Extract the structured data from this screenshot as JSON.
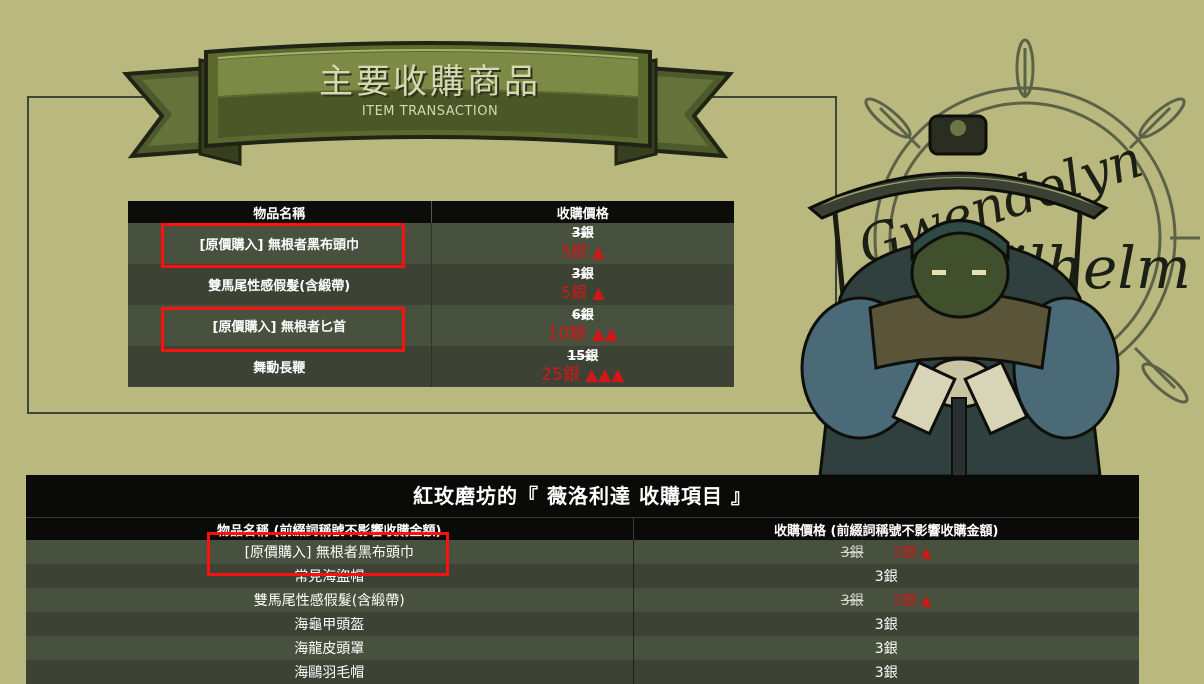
{
  "banner": {
    "title": "主要收購商品",
    "subtitle": "ITEM TRANSACTION"
  },
  "main_table": {
    "headers": [
      "物品名稱",
      "收購價格"
    ],
    "rows": [
      {
        "name": "[原價購入] 無根者黑布頭巾",
        "old_price": "3銀",
        "new_price": "5銀 ▲",
        "highlighted": true
      },
      {
        "name": "雙馬尾性感假髮(含緞帶)",
        "old_price": "3銀",
        "new_price": "5銀 ▲",
        "highlighted": false
      },
      {
        "name": "[原價購入] 無根者匕首",
        "old_price": "6銀",
        "new_price": "10銀 ▲▲",
        "highlighted": true
      },
      {
        "name": "舞動長鞭",
        "old_price": "15銀",
        "new_price": "25銀 ▲▲▲",
        "highlighted": false
      }
    ]
  },
  "lower_table": {
    "title": "紅玫磨坊的『  薇洛利達 收購項目  』",
    "headers": [
      "物品名稱 (前綴詞稱號不影響收購金額)",
      "收購價格 (前綴詞稱號不影響收購金額)"
    ],
    "rows": [
      {
        "name": "[原價購入] 無根者黑布頭巾",
        "old_price": "3銀",
        "new_price": "5銀 ▲",
        "highlighted": true
      },
      {
        "name": "常見海盜帽",
        "price": "3銀"
      },
      {
        "name": "雙馬尾性感假髮(含緞帶)",
        "old_price": "3銀",
        "new_price": "5銀 ▲"
      },
      {
        "name": "海龜甲頭盔",
        "price": "3銀"
      },
      {
        "name": "海龍皮頭罩",
        "price": "3銀"
      },
      {
        "name": "海鷗羽毛帽",
        "price": "3銀"
      }
    ]
  },
  "colors": {
    "background": "#b9b97f",
    "row_light": "#48503e",
    "row_dark": "#3c4334",
    "header_black": "#0a0a08",
    "price_up_red": "#d01818",
    "highlight_box": "#ff1010"
  }
}
